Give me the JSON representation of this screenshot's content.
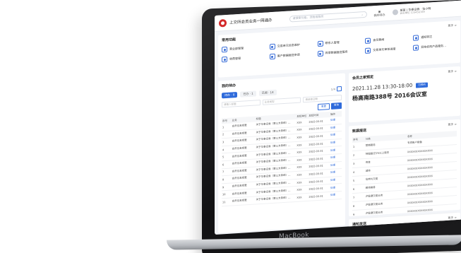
{
  "device": {
    "brand_label": "MacBook"
  },
  "app": {
    "title": "上交所会员业务一网通办",
    "search_placeholder": "请搜索功能、流程或服务",
    "todo_top_label": "我的待办",
    "user": {
      "name": "某某 | 华泰证券 · 张小明",
      "sub": "会员单位 123456789"
    }
  },
  "common_functions": {
    "title": "常用功能",
    "more_label": "更多 >",
    "items": [
      {
        "label": "营业部管理",
        "icon": "branch-icon"
      },
      {
        "label": "交易单元信息维护",
        "icon": "unit-icon"
      },
      {
        "label": "联系人管理",
        "icon": "contact-icon"
      },
      {
        "label": "会员要闻",
        "icon": "news-icon"
      },
      {
        "label": "通知转达",
        "icon": "notice-icon"
      },
      {
        "label": "收费管理",
        "icon": "fee-icon"
      },
      {
        "label": "客户数据报送申请",
        "icon": "report-icon"
      },
      {
        "label": "异常数据报送服务",
        "icon": "exception-icon"
      },
      {
        "label": "交易单元审核进度",
        "icon": "progress-icon"
      },
      {
        "label": "异地机构产品服务...",
        "icon": "product-icon"
      }
    ]
  },
  "todo": {
    "title": "我的待办",
    "tabs": [
      "待办 · 8",
      "已办 · 1",
      "已阅 · 14"
    ],
    "pager_text": "1/4",
    "filter_placeholders": [
      "请输入标题",
      "业务类型",
      "请选择日期"
    ],
    "btn_reset": "重置",
    "btn_search": "查询",
    "columns": [
      "序号",
      "业务",
      "标题",
      "发起单位",
      "发起时间",
      "操作"
    ],
    "rows": [
      [
        "1",
        "会员信息变更",
        "关于华泰证券（第三方系统）...",
        "XXX",
        "2022-03-31",
        "处理"
      ],
      [
        "2",
        "会员信息变更",
        "关于华泰证券（第三方系统）...",
        "XXX",
        "2022-03-31",
        "处理"
      ],
      [
        "3",
        "会员信息变更",
        "关于华泰证券（第三方系统）...",
        "XXX",
        "2022-03-31",
        "处理"
      ],
      [
        "4",
        "会员信息变更",
        "关于华泰证券（第三方系统）...",
        "XXX",
        "2022-03-31",
        "处理"
      ],
      [
        "5",
        "会员信息变更",
        "关于华泰证券（第三方系统）...",
        "XXX",
        "2022-03-31",
        "处理"
      ],
      [
        "6",
        "会员信息变更",
        "关于华泰证券（第三方系统）...",
        "XXX",
        "2022-03-31",
        "处理"
      ],
      [
        "7",
        "会员信息变更",
        "关于华泰证券（第三方系统）...",
        "XXX",
        "2022-03-31",
        "处理"
      ],
      [
        "8",
        "会员信息变更",
        "关于华泰证券（第三方系统）...",
        "XXX",
        "2022-03-31",
        "处理"
      ],
      [
        "9",
        "会员信息变更",
        "关于华泰证券（第三方系统）...",
        "XXX",
        "2022-03-31",
        "处理"
      ],
      [
        "10",
        "会员信息变更",
        "关于华泰证券（第三方系统）...",
        "XXX",
        "2022-03-31",
        "处理"
      ],
      [
        "11",
        "会员信息变更",
        "关于华泰证券（第三方系统）...",
        "XXX",
        "2022-03-31",
        "处理"
      ]
    ]
  },
  "meeting": {
    "title": "会员之家预定",
    "more_label": "更多 >",
    "time": "2021.11.28  13:30-18:00",
    "tag": "已预约",
    "place": "杨高南路388号 2016会议室"
  },
  "data_report": {
    "title": "数据报送",
    "more_label": "更多 >",
    "columns": [
      "序号",
      "分类",
      "名称"
    ],
    "rows": [
      [
        "1",
        "营销服务",
        "专项账户报备"
      ],
      [
        "2",
        "持股超过5%以上股东",
        "XXXXXXXXXXXXXXX"
      ],
      [
        "3",
        "资金",
        "XXXXXXXXXXXXXXX"
      ],
      [
        "4",
        "减持",
        "XXXXXXXXXXXXXXX"
      ],
      [
        "5",
        "信用与交易",
        "XXXXXXXXXXXXXXX"
      ],
      [
        "6",
        "融资融券",
        "XXXXXXXXXXXXXXX"
      ],
      [
        "7",
        "沪股通交易业务",
        "XXXXXXXXXXXXXXX"
      ],
      [
        "8",
        "沪股通交易业务",
        "XXXXXXXXXXXXXXX"
      ],
      [
        "9",
        "沪股通交易业务",
        "XXXXXXXXXXXXXXX"
      ]
    ]
  },
  "notice": {
    "title": "通知发送",
    "more_label": "更多 >"
  }
}
